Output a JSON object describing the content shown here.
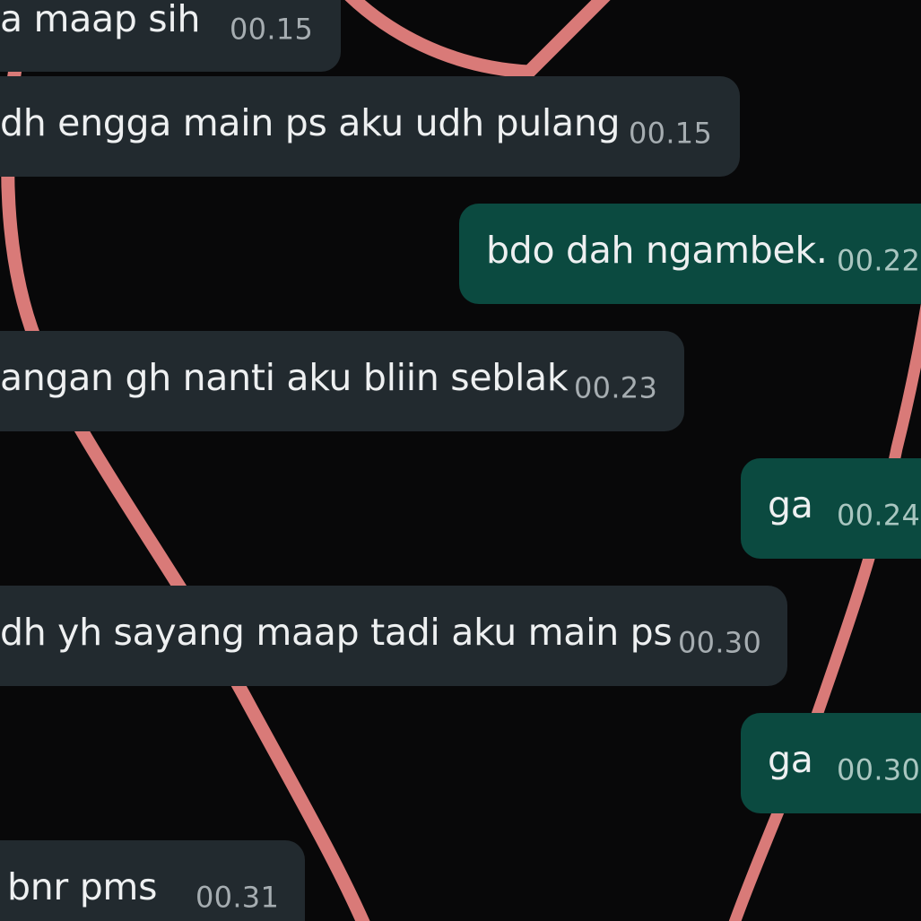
{
  "colors": {
    "background": "#080809",
    "incoming_bubble": "#222a2f",
    "outgoing_bubble": "#0b4a40",
    "heart_line": "#d97a78",
    "message_text": "#eef0f1"
  },
  "wallpaper": {
    "icon": "heart-outline-icon"
  },
  "messages": [
    {
      "direction": "incoming",
      "text": "a maap sih",
      "time": "00.15"
    },
    {
      "direction": "incoming",
      "text": "dh engga main ps aku udh pulang",
      "time": "00.15"
    },
    {
      "direction": "outgoing",
      "text": "bdo dah ngambek.",
      "time": "00.22"
    },
    {
      "direction": "incoming",
      "text": "angan gh nanti aku bliin seblak",
      "time": "00.23"
    },
    {
      "direction": "outgoing",
      "text": "ga",
      "time": "00.24"
    },
    {
      "direction": "incoming",
      "text": "dh yh sayang maap tadi aku main ps",
      "time": "00.30"
    },
    {
      "direction": "outgoing",
      "text": "ga",
      "time": "00.30"
    },
    {
      "direction": "incoming",
      "text": "bnr pms",
      "time": "00.31"
    }
  ]
}
